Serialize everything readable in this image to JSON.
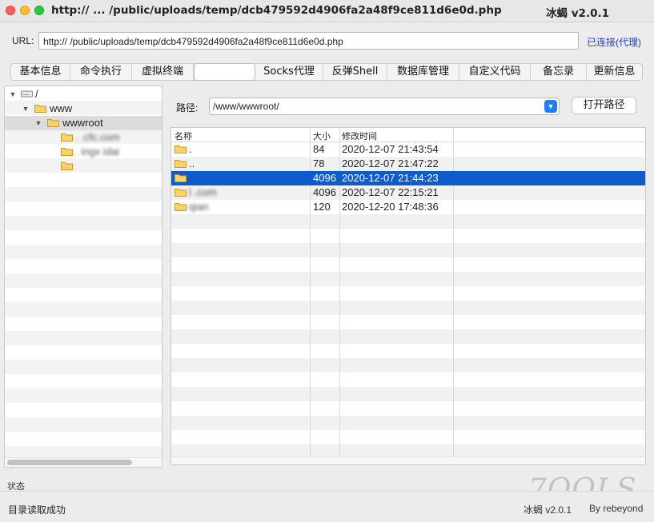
{
  "window": {
    "title": "http://  ...  /public/uploads/temp/dcb479592d4906fa2a48f9ce811d6e0d.php",
    "app_name": "冰蝎 v2.0.1"
  },
  "url_bar": {
    "label": "URL:",
    "value": "http://                              /public/uploads/temp/dcb479592d4906fa2a48f9ce811d6e0d.php",
    "connection_status": "已连接(代理)"
  },
  "tabs": [
    {
      "label": "基本信息"
    },
    {
      "label": "命令执行"
    },
    {
      "label": "虚拟终端"
    },
    {
      "label": "",
      "active": true
    },
    {
      "label": "Socks代理"
    },
    {
      "label": "反弹Shell"
    },
    {
      "label": "数据库管理"
    },
    {
      "label": "自定义代码"
    },
    {
      "label": "备忘录"
    },
    {
      "label": "更新信息"
    }
  ],
  "tree": {
    "items": [
      {
        "label": "/",
        "icon": "drive-icon"
      },
      {
        "label": "www",
        "icon": "folder-icon"
      },
      {
        "label": "wwwroot",
        "icon": "folder-icon",
        "selected": true
      },
      {
        "label": "  .  .cfc.com",
        "icon": "folder-icon"
      },
      {
        "label": "  .  ingx   idai",
        "icon": "folder-icon"
      },
      {
        "label": "",
        "icon": "folder-icon"
      }
    ]
  },
  "path": {
    "label": "路径:",
    "value": "/www/wwwroot/",
    "open_button": "打开路径"
  },
  "file_table": {
    "columns": [
      "名称",
      "大小",
      "修改时间"
    ],
    "rows": [
      {
        "name": ".",
        "size": "84",
        "modified": "2020-12-07 21:43:54",
        "selected": false
      },
      {
        "name": "..",
        "size": "78",
        "modified": "2020-12-07 21:47:22",
        "selected": false
      },
      {
        "name": "",
        "size": "4096",
        "modified": "2020-12-07 21:44:23",
        "selected": true
      },
      {
        "name": "l                          .com",
        "size": "4096",
        "modified": "2020-12-07 22:15:21",
        "selected": false
      },
      {
        "name": "qian                       ",
        "size": "120",
        "modified": "2020-12-20 17:48:36",
        "selected": false
      }
    ]
  },
  "status": {
    "label": "状态",
    "message": "目录读取成功",
    "version": "冰蝎 v2.0.1",
    "author": "By rebeyond"
  },
  "watermark": "7OOLS",
  "colors": {
    "selection": "#0d5ccd",
    "link": "#1a3fd6",
    "select_button": "#1f7ef5"
  }
}
